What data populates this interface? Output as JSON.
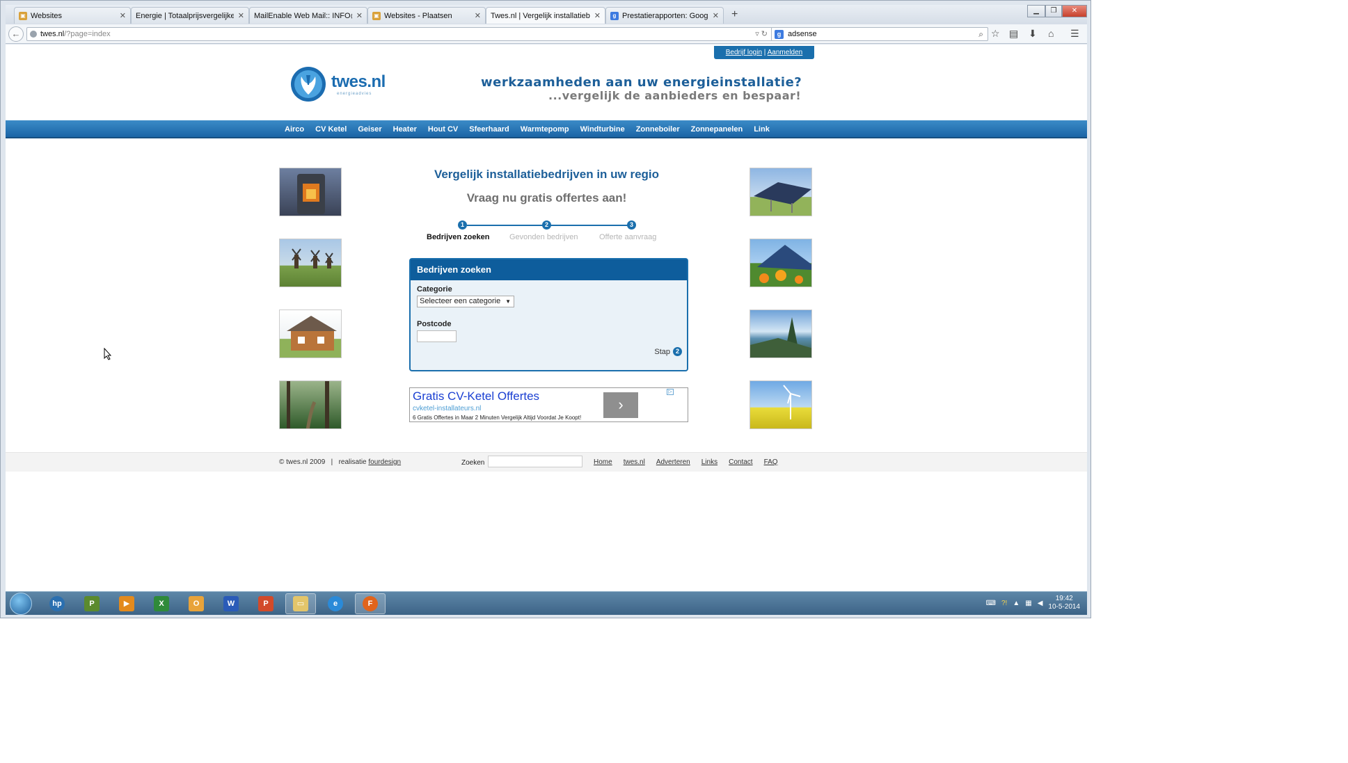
{
  "browser": {
    "tabs": [
      {
        "title": "Websites",
        "icon": "website-icon",
        "active": false
      },
      {
        "title": "Energie | Totaalprijsvergelijker.nl",
        "icon": "",
        "active": false
      },
      {
        "title": "MailEnable Web Mail:: INFO@T...",
        "icon": "",
        "active": false
      },
      {
        "title": "Websites - Plaatsen",
        "icon": "website-icon",
        "active": false
      },
      {
        "title": "Twes.nl | Vergelijk installatiebe...",
        "icon": "",
        "active": true
      },
      {
        "title": "Prestatierapporten: Google...",
        "icon": "google-icon",
        "active": false
      }
    ],
    "url_host": "twes.nl",
    "url_path": "/?page=index",
    "search_value": "adsense",
    "search_engine_icon": "g"
  },
  "site": {
    "login_link": "Bedrijf login",
    "login_sep": "|",
    "register_link": "Aanmelden",
    "logo_text": "twes.nl",
    "logo_sub": "energieadvies",
    "tagline1": "werkzaamheden aan uw energieinstallatie?",
    "tagline2": "...vergelijk de aanbieders en bespaar!",
    "menu": [
      "Airco",
      "CV Ketel",
      "Geiser",
      "Heater",
      "Hout CV",
      "Sfeerhaard",
      "Warmtepomp",
      "Windturbine",
      "Zonneboiler",
      "Zonnepanelen",
      "Link"
    ],
    "heading1": "Vergelijk installatiebedrijven in uw regio",
    "heading2": "Vraag nu gratis offertes aan!",
    "steps": [
      {
        "num": "1",
        "label": "Bedrijven zoeken",
        "active": true
      },
      {
        "num": "2",
        "label": "Gevonden bedrijven",
        "active": false
      },
      {
        "num": "3",
        "label": "Offerte aanvraag",
        "active": false
      }
    ],
    "form": {
      "title": "Bedrijven zoeken",
      "category_label": "Categorie",
      "category_value": "Selecteer een categorie",
      "postcode_label": "Postcode",
      "postcode_value": "",
      "next_label": "Stap",
      "next_num": "2"
    },
    "ad": {
      "title": "Gratis CV-Ketel Offertes",
      "url": "cvketel-installateurs.nl",
      "text": "6 Gratis Offertes in Maar 2 Minuten Vergelijk Altijd Voordat Je Koopt!",
      "arrow": "›"
    },
    "footer": {
      "copyright": "© twes.nl 2009",
      "sep": "|",
      "credit_prefix": "realisatie",
      "credit_link": "fourdesign",
      "search_label": "Zoeken",
      "search_value": "",
      "links": [
        "Home",
        "twes.nl",
        "Adverteren",
        "Links",
        "Contact",
        "FAQ"
      ]
    }
  },
  "taskbar": {
    "apps": [
      "hp-icon",
      "project-icon",
      "media-player-icon",
      "excel-icon",
      "outlook-icon",
      "word-icon",
      "powerpoint-icon",
      "explorer-icon",
      "internet-explorer-icon",
      "firefox-icon"
    ],
    "active_app": "firefox-icon",
    "time": "19:42",
    "date": "10-5-2014"
  },
  "colors": {
    "brand_blue": "#1a6fad",
    "menu_blue": "#2a79b9",
    "ad_title": "#1a3fd2"
  }
}
